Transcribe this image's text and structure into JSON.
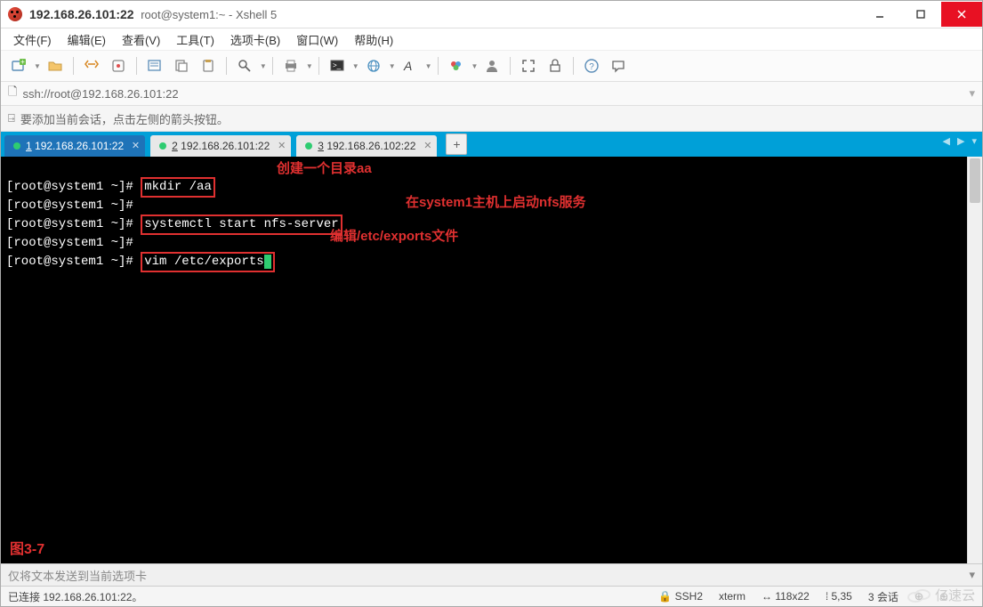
{
  "title": {
    "ip": "192.168.26.101:22",
    "rest": "root@system1:~ - Xshell 5"
  },
  "menu": {
    "file": "文件(F)",
    "edit": "编辑(E)",
    "view": "查看(V)",
    "tools": "工具(T)",
    "tabs": "选项卡(B)",
    "window": "窗口(W)",
    "help": "帮助(H)"
  },
  "address": {
    "url": "ssh://root@192.168.26.101:22"
  },
  "hint": {
    "text": "要添加当前会话，点击左侧的箭头按钮。"
  },
  "tabs": [
    {
      "num": "1",
      "label": "192.168.26.101:22",
      "active": true
    },
    {
      "num": "2",
      "label": "192.168.26.101:22",
      "active": false
    },
    {
      "num": "3",
      "label": "192.168.26.102:22",
      "active": false
    }
  ],
  "term": {
    "prompt": "[root@system1 ~]#",
    "cmd1": "mkdir /aa",
    "cmd2": "systemctl start nfs-server",
    "cmd3": "vim /etc/exports",
    "annot1": "创建一个目录aa",
    "annot2": "在system1主机上启动nfs服务",
    "annot3": "编辑/etc/exports文件",
    "fig": "图3-7"
  },
  "sendbar": {
    "text": "仅将文本发送到当前选项卡"
  },
  "status": {
    "conn": "已连接 192.168.26.101:22。",
    "proto": "SSH2",
    "termtype": "xterm",
    "size": "118x22",
    "pos": "5,35",
    "sessions": "3 会话"
  },
  "watermark": "亿速云"
}
